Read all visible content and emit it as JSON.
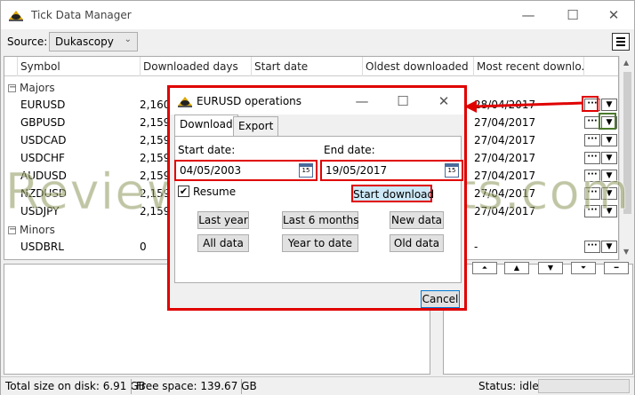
{
  "window": {
    "title": "Tick Data Manager",
    "minimize": "—",
    "maximize": "☐",
    "close": "✕"
  },
  "toolbar": {
    "source_label": "Source:",
    "source_value": "Dukascopy"
  },
  "grid": {
    "headers": [
      "Symbol",
      "Downloaded days",
      "Start date",
      "Oldest downloaded",
      "Most recent downlo..."
    ],
    "groups": [
      {
        "name": "Majors",
        "toggle": "−"
      },
      {
        "name": "Minors",
        "toggle": "−"
      }
    ],
    "rows": [
      {
        "symbol": "EURUSD",
        "days": "2,160",
        "recent": "28/04/2017"
      },
      {
        "symbol": "GBPUSD",
        "days": "2,159",
        "recent": "27/04/2017"
      },
      {
        "symbol": "USDCAD",
        "days": "2,159",
        "recent": "27/04/2017"
      },
      {
        "symbol": "USDCHF",
        "days": "2,159",
        "recent": "27/04/2017"
      },
      {
        "symbol": "AUDUSD",
        "days": "2,159",
        "recent": "27/04/2017"
      },
      {
        "symbol": "NZDUSD",
        "days": "2,159",
        "recent": "27/04/2017"
      },
      {
        "symbol": "USDJPY",
        "days": "2,159",
        "recent": "27/04/2017"
      }
    ],
    "minor_rows": [
      {
        "symbol": "USDBRL",
        "days": "0",
        "recent": "-"
      }
    ],
    "dots_label": "···",
    "dropdown_glyph": "▼"
  },
  "dialog": {
    "title": "EURUSD operations",
    "tabs": [
      "Download",
      "Export"
    ],
    "start_label": "Start date:",
    "start_value": "04/05/2003",
    "end_label": "End date:",
    "end_value": "19/05/2017",
    "cal_label": "15",
    "resume_label": "Resume",
    "start_download": "Start download",
    "buttons": [
      "Last year",
      "Last 6 months",
      "New data",
      "All data",
      "Year to date",
      "Old data"
    ],
    "cancel": "Cancel"
  },
  "nav_buttons": [
    "⏶",
    "▲",
    "▼",
    "⏷",
    "━"
  ],
  "status": {
    "disk": "Total size on disk: 6.91 GB",
    "free": "Free space: 139.67 GB",
    "state": "Status: idle"
  },
  "watermark": "ReviewForexRobots.com",
  "colors": {
    "highlight": "#e00000",
    "accent": "#0078d7",
    "start_button_bg": "#cde8f6"
  }
}
